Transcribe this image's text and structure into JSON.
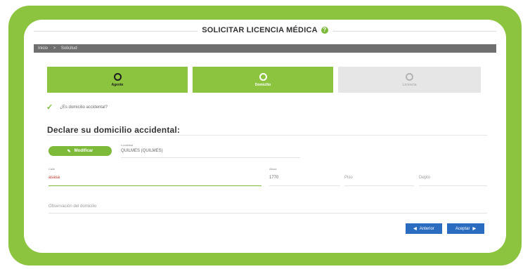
{
  "window": {
    "title": "SOLICITAR LICENCIA MÉDICA"
  },
  "breadcrumb": {
    "items": [
      "Inicio",
      ">",
      "Solicitud"
    ]
  },
  "steps": [
    {
      "label": "Agente",
      "state": "done"
    },
    {
      "label": "Domicilio",
      "state": "active"
    },
    {
      "label": "Licencia",
      "state": "pending"
    }
  ],
  "question": {
    "text": "¿Es domicilio accidental?"
  },
  "section": {
    "title": "Declare su domicilio accidental:"
  },
  "modify_button": {
    "label": "Modificar"
  },
  "locality": {
    "label": "Localidad",
    "value": "QUILMES (QUILMES)"
  },
  "street": {
    "label": "Calle",
    "value": "asasa"
  },
  "height": {
    "label": "Altura",
    "value": "1770"
  },
  "floor": {
    "placeholder": "Piso"
  },
  "dept": {
    "placeholder": "Depto"
  },
  "observation": {
    "placeholder": "Observación del domicilio"
  },
  "nav": {
    "back_label": "Anterior",
    "accept_label": "Aceptar"
  },
  "colors": {
    "accent_green": "#8cc43f",
    "button_blue": "#2a6cc0",
    "breadcrumb_gray": "#6f6f6f"
  }
}
